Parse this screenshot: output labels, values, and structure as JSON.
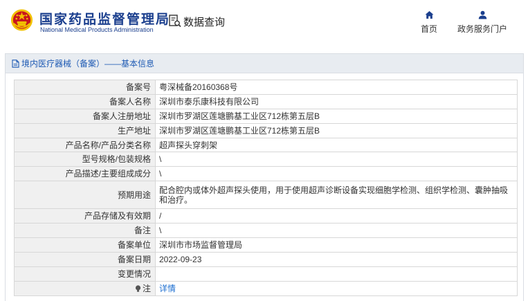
{
  "header": {
    "logo_cn": "国家药品监督管理局",
    "logo_en": "National Medical Products Administration",
    "page_title": "数据查询",
    "nav": [
      {
        "label": "首页",
        "icon": "home-icon"
      },
      {
        "label": "政务服务门户",
        "icon": "user-icon"
      }
    ]
  },
  "panel": {
    "title": "境内医疗器械（备案）——基本信息"
  },
  "rows": [
    {
      "key": "备案号",
      "value": "粤深械备20160368号"
    },
    {
      "key": "备案人名称",
      "value": "深圳市泰乐康科技有限公司"
    },
    {
      "key": "备案人注册地址",
      "value": "深圳市罗湖区莲塘鹏基工业区712栋第五层B"
    },
    {
      "key": "生产地址",
      "value": "深圳市罗湖区莲塘鹏基工业区712栋第五层B"
    },
    {
      "key": "产品名称/产品分类名称",
      "value": "超声探头穿刺架"
    },
    {
      "key": "型号规格/包装规格",
      "value": "\\"
    },
    {
      "key": "产品描述/主要组成成分",
      "value": "\\"
    },
    {
      "key": "预期用途",
      "value": "配合腔内或体外超声探头使用，用于使用超声诊断设备实现细胞学检测、组织学检测、囊肿抽吸和治疗。"
    },
    {
      "key": "产品存储及有效期",
      "value": "/"
    },
    {
      "key": "备注",
      "value": "\\"
    },
    {
      "key": "备案单位",
      "value": "深圳市市场监督管理局"
    },
    {
      "key": "备案日期",
      "value": "2022-09-23"
    },
    {
      "key": "变更情况",
      "value": ""
    },
    {
      "key": "注",
      "value": "详情"
    }
  ],
  "colors": {
    "brand": "#1b3f8e",
    "link": "#1e6fd0",
    "emblem_red": "#c8161d",
    "emblem_gold": "#f2c200"
  }
}
